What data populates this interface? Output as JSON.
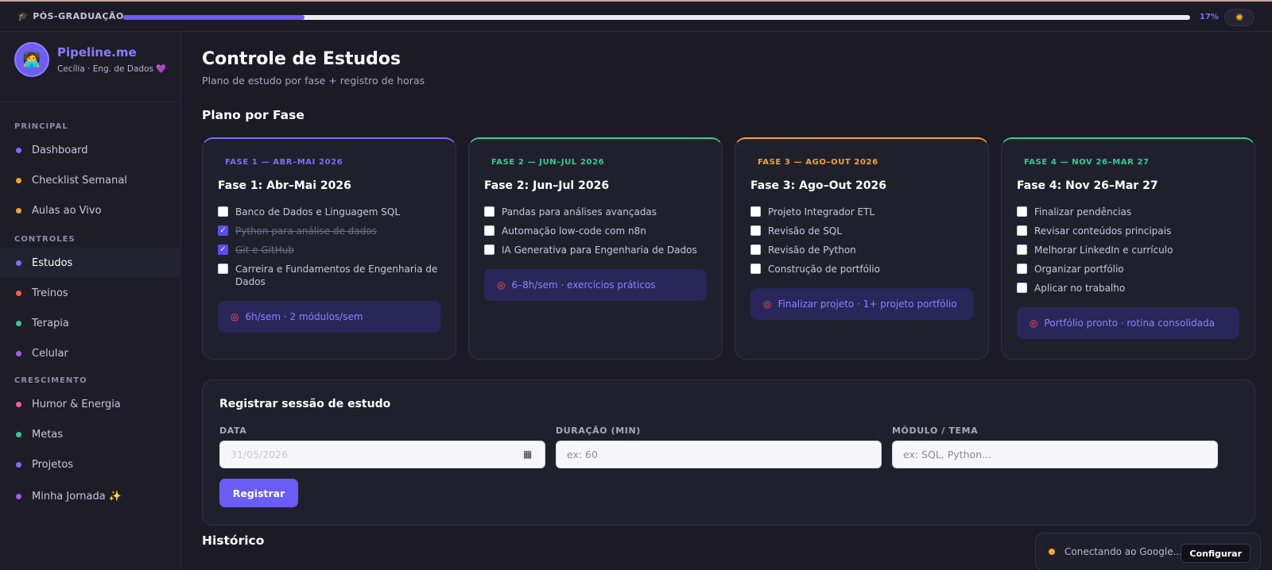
{
  "topbar": {
    "label": "PÓS-GRADUAÇÃO",
    "cap_icon": "graduation-cap-icon",
    "progress_percent": 17,
    "progress_text": "17%",
    "theme_icon": "sun-icon"
  },
  "sidebar": {
    "brand": "Pipeline.me",
    "subtitle": "Cecília · Eng. de Dados",
    "subtitle_emoji": "💜",
    "avatar_icon": "person-at-laptop-icon",
    "sections": {
      "principal": "PRINCIPAL",
      "controles": "CONTROLES",
      "crescimento": "CRESCIMENTO"
    },
    "items": [
      {
        "label": "Dashboard",
        "color": "#7c6cff"
      },
      {
        "label": "Checklist Semanal",
        "color": "#f5a524"
      },
      {
        "label": "Aulas ao Vivo",
        "color": "#f5a524"
      },
      {
        "label": "Estudos",
        "color": "#7c6cff",
        "active": true
      },
      {
        "label": "Treinos",
        "color": "#ff5a5a"
      },
      {
        "label": "Terapia",
        "color": "#2fce8f"
      },
      {
        "label": "Celular",
        "color": "#a259ff"
      },
      {
        "label": "Humor & Energia",
        "color": "#f0609b"
      },
      {
        "label": "Metas",
        "color": "#2fce8f"
      },
      {
        "label": "Projetos",
        "color": "#7c6cff"
      },
      {
        "label": "Minha Jornada ✨",
        "color": "#a259ff"
      }
    ]
  },
  "main": {
    "title": "Controle de Estudos",
    "subtitle": "Plano de estudo por fase + registro de horas",
    "plan_heading": "Plano por Fase",
    "phases": [
      {
        "tag": "FASE 1 — ABR–MAI 2026",
        "title": "Fase 1: Abr–Mai 2026",
        "color": "#7c6cff",
        "items": [
          {
            "text": "Banco de Dados e Linguagem SQL",
            "done": false
          },
          {
            "text": "Python para análise de dados",
            "done": true
          },
          {
            "text": "Git e GitHub",
            "done": true
          },
          {
            "text": "Carreira e Fundamentos de Engenharia de Dados",
            "done": false
          }
        ],
        "goal": "6h/sem · 2 módulos/sem"
      },
      {
        "tag": "FASE 2 — JUN–JUL 2026",
        "title": "Fase 2: Jun–Jul 2026",
        "color": "#2fce8f",
        "items": [
          {
            "text": "Pandas para análises avançadas",
            "done": false
          },
          {
            "text": "Automação low-code com n8n",
            "done": false
          },
          {
            "text": "IA Generativa para Engenharia de Dados",
            "done": false
          }
        ],
        "goal": "6–8h/sem · exercícios práticos"
      },
      {
        "tag": "FASE 3 — AGO–OUT 2026",
        "title": "Fase 3: Ago–Out 2026",
        "color": "#f5a524",
        "items": [
          {
            "text": "Projeto Integrador ETL",
            "done": false
          },
          {
            "text": "Revisão de SQL",
            "done": false
          },
          {
            "text": "Revisão de Python",
            "done": false
          },
          {
            "text": "Construção de portfólio",
            "done": false
          }
        ],
        "goal": "Finalizar projeto · 1+ projeto portfólio"
      },
      {
        "tag": "FASE 4 — NOV 26–MAR 27",
        "title": "Fase 4: Nov 26–Mar 27",
        "color": "#2fce8f",
        "items": [
          {
            "text": "Finalizar pendências",
            "done": false
          },
          {
            "text": "Revisar conteúdos principais",
            "done": false
          },
          {
            "text": "Melhorar LinkedIn e currículo",
            "done": false
          },
          {
            "text": "Organizar portfólio",
            "done": false
          },
          {
            "text": "Aplicar no trabalho",
            "done": false
          }
        ],
        "goal": "Portfólio pronto · rotina consolidada"
      }
    ],
    "goal_icon": "target-icon",
    "register": {
      "title": "Registrar sessão de estudo",
      "date_label": "DATA",
      "date_value": "31/05/2026",
      "duration_label": "DURAÇÃO (MIN)",
      "duration_placeholder": "ex: 60",
      "topic_label": "MÓDULO / TEMA",
      "topic_placeholder": "ex: SQL, Python...",
      "button": "Registrar"
    },
    "history_heading": "Histórico"
  },
  "toast": {
    "text": "Conectando ao Google...",
    "button": "Configurar",
    "color": "#f5a524"
  }
}
